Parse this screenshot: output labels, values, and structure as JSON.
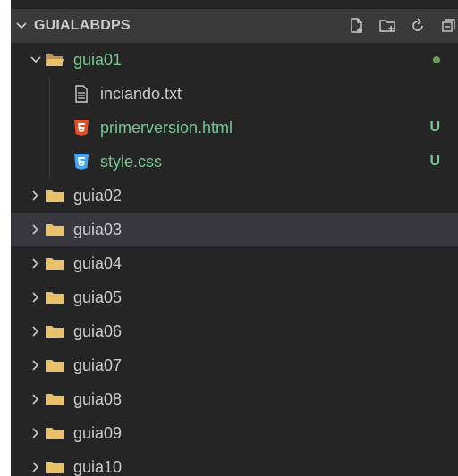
{
  "colors": {
    "background": "#252526",
    "header_bg": "#3a3a3a",
    "selected_row_bg": "#37373d",
    "folder": "#e8c26a",
    "html_icon": "#e44d26",
    "css_icon": "#42a5f5",
    "git_untracked": "#73c991",
    "text": "#cccccc"
  },
  "explorer": {
    "root_label": "GUIALABDPS",
    "actions": [
      {
        "name": "new-file-icon"
      },
      {
        "name": "new-folder-icon"
      },
      {
        "name": "refresh-icon"
      },
      {
        "name": "collapse-all-icon"
      }
    ]
  },
  "tree": {
    "guia01": {
      "label": "guia01",
      "expanded": true,
      "status_dot": "modified",
      "children": [
        {
          "label": "inciando.txt",
          "icon": "text-file-icon",
          "status": ""
        },
        {
          "label": "primerversion.html",
          "icon": "html5-icon",
          "status": "U"
        },
        {
          "label": "style.css",
          "icon": "css3-icon",
          "status": "U"
        }
      ]
    },
    "folders": [
      {
        "label": "guia02"
      },
      {
        "label": "guia03",
        "selected": true
      },
      {
        "label": "guia04"
      },
      {
        "label": "guia05"
      },
      {
        "label": "guia06"
      },
      {
        "label": "guia07"
      },
      {
        "label": "guia08"
      },
      {
        "label": "guia09"
      },
      {
        "label": "guia10"
      }
    ]
  }
}
